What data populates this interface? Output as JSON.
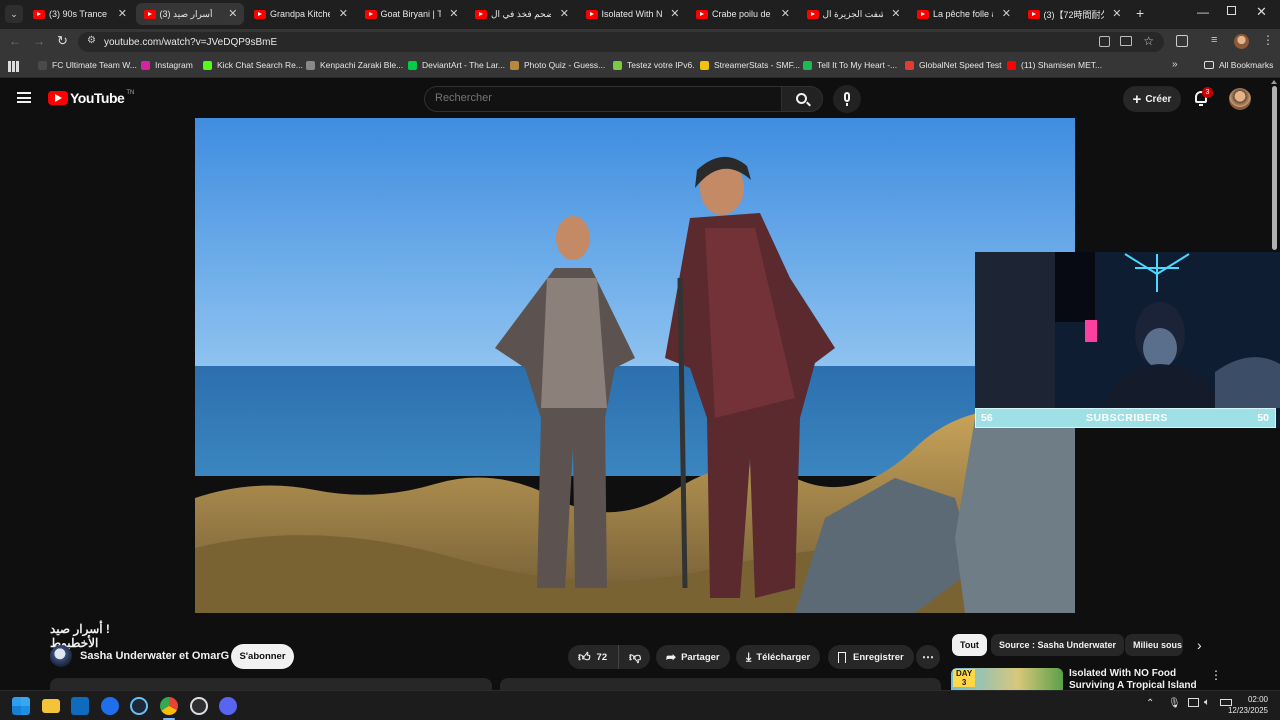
{
  "browser": {
    "tabs": [
      {
        "label": "(3) 90s Trance Cla",
        "active": false
      },
      {
        "label": "أسرار صيد (3)",
        "active": true
      },
      {
        "label": "Grandpa Kitchen",
        "active": false
      },
      {
        "label": "Goat Biryani | Tra",
        "active": false
      },
      {
        "label": "أضحم فخذ في ال",
        "active": false
      },
      {
        "label": "Isolated With NO",
        "active": false
      },
      {
        "label": "Crabe poilu de Sa",
        "active": false
      },
      {
        "label": "اكتشفت الجزيرة ال",
        "active": false
      },
      {
        "label": "La pêche folle au",
        "active": false
      },
      {
        "label": "(3)【72時間耐久】",
        "active": false
      }
    ],
    "url": "youtube.com/watch?v=JVeDQP9sBmE",
    "bookmarks": [
      {
        "label": "FC Ultimate Team W...",
        "color": "#4a4a4a"
      },
      {
        "label": "Instagram",
        "color": "#d6249f"
      },
      {
        "label": "Kick Chat Search Re...",
        "color": "#53fc18"
      },
      {
        "label": "Kenpachi Zaraki Ble...",
        "color": "#888888"
      },
      {
        "label": "DeviantArt - The Lar...",
        "color": "#05cc47"
      },
      {
        "label": "Photo Quiz - Guess...",
        "color": "#b58a3c"
      },
      {
        "label": "Testez votre IPv6.",
        "color": "#7ac943"
      },
      {
        "label": "StreamerStats - SMF...",
        "color": "#f4c20d"
      },
      {
        "label": "Tell It To My Heart -...",
        "color": "#1db954"
      },
      {
        "label": "GlobalNet Speed Test",
        "color": "#e53935"
      },
      {
        "label": "(11) Shamisen MET...",
        "color": "#ff0000"
      }
    ],
    "all_bookmarks": "All Bookmarks"
  },
  "youtube": {
    "logo": "YouTube",
    "logo_tm": "TN",
    "search_placeholder": "Rechercher",
    "create_label": "Créer",
    "notifications_count": "3"
  },
  "overlay": {
    "left_count": "56",
    "label": "SUBSCRIBERS",
    "right_count": "50"
  },
  "video": {
    "title": "! أسرار صيد الأخطبوط",
    "channel": "Sasha Underwater et OmarG",
    "subscribe": "S'abonner",
    "likes": "72",
    "share": "Partager",
    "download": "Télécharger",
    "save": "Enregistrer"
  },
  "sidebar": {
    "chips": [
      "Tout",
      "Source : Sasha Underwater",
      "Milieu sous"
    ],
    "next_video_title": "Isolated With NO Food Surviving A Tropical Island",
    "next_video_badge_line1": "DAY",
    "next_video_badge_line2": "3"
  },
  "taskbar": {
    "time": "02:00",
    "date": "12/23/2025"
  }
}
